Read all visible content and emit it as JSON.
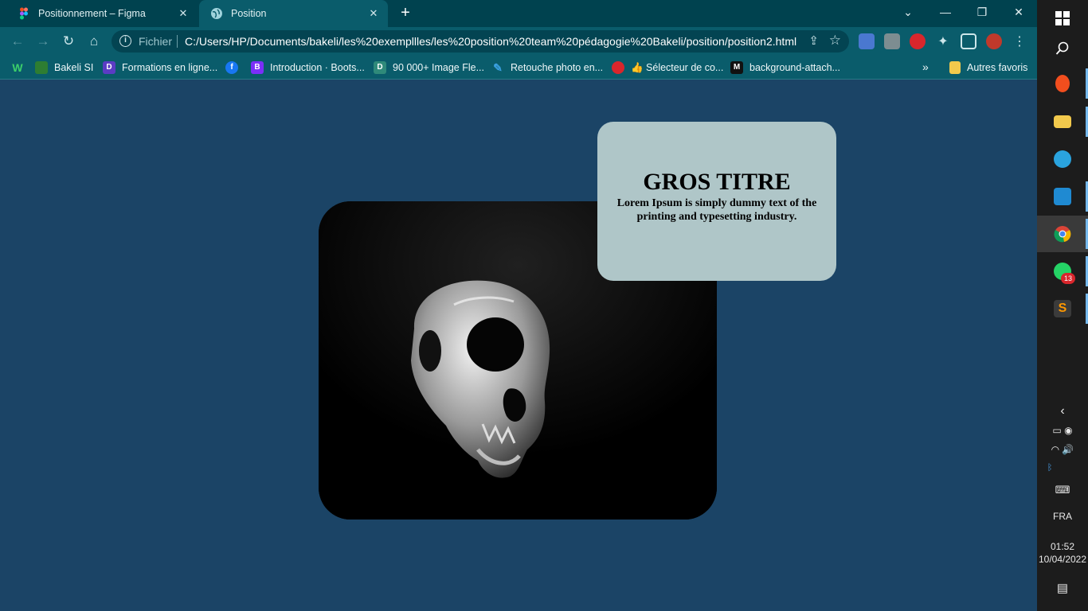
{
  "tabs": [
    {
      "title": "Positionnement – Figma",
      "favicon": "figma-icon",
      "active": false
    },
    {
      "title": "Position",
      "favicon": "globe-icon",
      "active": true
    }
  ],
  "toolbar": {
    "scheme_label": "Fichier",
    "url": "C:/Users/HP/Documents/bakeli/les%20exempllles/les%20position%20team%20pédagogie%20Bakeli/position/position2.html"
  },
  "bookmarks": [
    {
      "label": "Bakeli SI",
      "icon": "bakeli-icon",
      "color": "#2e7d32"
    },
    {
      "label": "Formations en ligne...",
      "icon": "d-icon",
      "color": "#5b3cc4"
    },
    {
      "label": "",
      "icon": "facebook-icon",
      "color": "#1877f2"
    },
    {
      "label": "Introduction · Boots...",
      "icon": "bootstrap-icon",
      "color": "#7b2ff7"
    },
    {
      "label": "90 000+ Image Fle...",
      "icon": "image-icon",
      "color": "#2f8a7a"
    },
    {
      "label": "Retouche photo en...",
      "icon": "pixlr-icon",
      "color": "#3aa0e0"
    },
    {
      "label": "👍 Sélecteur de co...",
      "icon": "colorpicker-icon",
      "color": "#d9262c"
    },
    {
      "label": "background-attach...",
      "icon": "m-icon",
      "color": "#111111"
    }
  ],
  "bookmarks_other": "Autres favoris",
  "card": {
    "heading": "GROS TITRE",
    "body": "Lorem Ipsum is simply dummy text of the printing and typesetting industry."
  },
  "taskbar": {
    "language": "FRA",
    "time": "01:52",
    "date": "10/04/2022",
    "whatsapp_badge": "13"
  },
  "colors": {
    "page_background": "#1b4466",
    "card_background": "#afc6c8",
    "chrome_frame": "#00424f",
    "chrome_toolbar": "#0a5c6b"
  }
}
